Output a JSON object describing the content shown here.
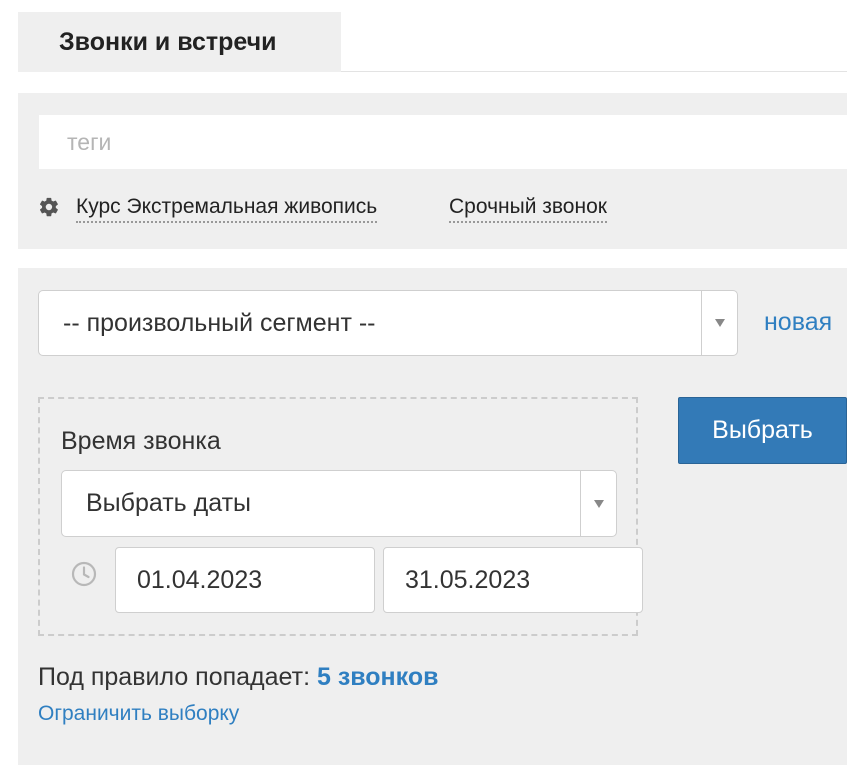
{
  "header": {
    "tab_label": "Звонки и встречи"
  },
  "tags": {
    "placeholder": "теги",
    "value": "",
    "settings_icon": "gear-icon",
    "items": [
      {
        "label": "Курс Экстремальная живопись"
      },
      {
        "label": "Срочный звонок"
      }
    ]
  },
  "segment": {
    "selected": "-- произвольный сегмент --",
    "new_label": "новая",
    "arrow_icon": "triangle-down-icon"
  },
  "condition": {
    "label": "Время звонка",
    "period_selected": "Выбрать даты",
    "clock_icon": "clock-icon",
    "date_from": "01.04.2023",
    "date_to": "31.05.2023"
  },
  "actions": {
    "choose_label": "Выбрать"
  },
  "summary": {
    "prefix": "Под правило попадает:",
    "count_label": "5 звонков",
    "limit_label": "Ограничить выборку"
  },
  "colors": {
    "accent": "#337ab7",
    "link": "#2f7fc1",
    "panel_bg": "#efefef"
  }
}
